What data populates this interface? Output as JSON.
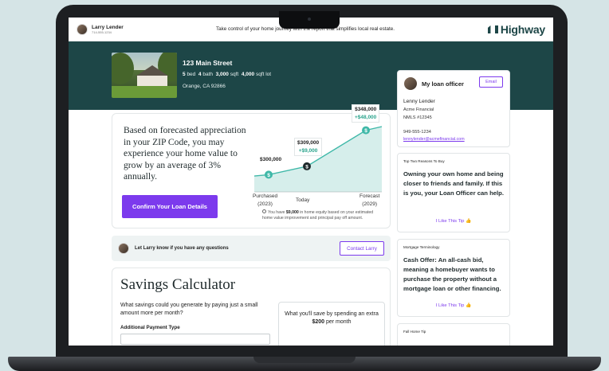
{
  "topbar": {
    "agent_name": "Larry Lender",
    "agent_phone": "714-555-1234",
    "tagline": "Take control of your home journey with the report that simplifies local real estate.",
    "brand": "Highway"
  },
  "property": {
    "address": "123 Main Street",
    "beds": "5",
    "beds_label": "bed",
    "baths": "4",
    "baths_label": "bath",
    "sqft": "3,000",
    "sqft_label": "sqft",
    "lot": "4,000",
    "lot_label": "sqft lot",
    "city": "Orange, CA 92866"
  },
  "forecast": {
    "text": "Based on forecasted appreciation in your ZIP Code, you may experience your home value to grow by an average of 3% annually.",
    "cta_label": "Confirm Your Loan Details",
    "note_prefix": "You have ",
    "note_value": "$9,000",
    "note_suffix": " in home equity based on your estimated home value improvement and principal pay off amount."
  },
  "chart_data": {
    "type": "line",
    "points": [
      {
        "label": "$300,000",
        "value": 300000
      },
      {
        "label": "$309,000",
        "value": 309000,
        "delta": "+$9,000"
      },
      {
        "label": "$348,000",
        "value": 348000,
        "delta": "+$48,000"
      }
    ],
    "x_labels": [
      {
        "line1": "Purchased",
        "line2": "(2023)"
      },
      {
        "line1": "Today",
        "line2": ""
      },
      {
        "line1": "Forecast",
        "line2": "(2029)"
      }
    ],
    "line_color": "#3fb8a8",
    "area_color": "#d6eeeb"
  },
  "contact": {
    "text": "Let Larry know if you have any questions",
    "button": "Contact Larry"
  },
  "savings": {
    "title": "Savings Calculator",
    "question": "What savings could you generate by paying just a small amount more per month?",
    "payment_type_label": "Additional Payment Type",
    "box_prefix": "What you'll save by spending an extra ",
    "box_amount": "$200",
    "box_suffix": " per month"
  },
  "loan_officer": {
    "title": "My loan officer",
    "email_button": "Email",
    "name": "Lenny Lender",
    "company": "Acme Financial",
    "nmls": "NMLS #12345",
    "phone": "949-555-1234",
    "email": "lennylender@acmefinancial.com"
  },
  "tips": [
    {
      "kicker": "Top Two Reasons To Buy",
      "body": "Owning your own home and being closer to friends and family. If this is you, your Loan Officer can help.",
      "like": "I Like This Tip 👍"
    },
    {
      "kicker": "Mortgage Terminology",
      "body": "Cash Offer: An all-cash bid, meaning a homebuyer wants to purchase the property without a mortgage loan or other financing.",
      "like": "I Like This Tip 👍"
    },
    {
      "kicker": "Fall Home Tip",
      "body": "",
      "like": ""
    }
  ],
  "colors": {
    "accent": "#7c3aed",
    "brand_dark": "#1d4647"
  }
}
